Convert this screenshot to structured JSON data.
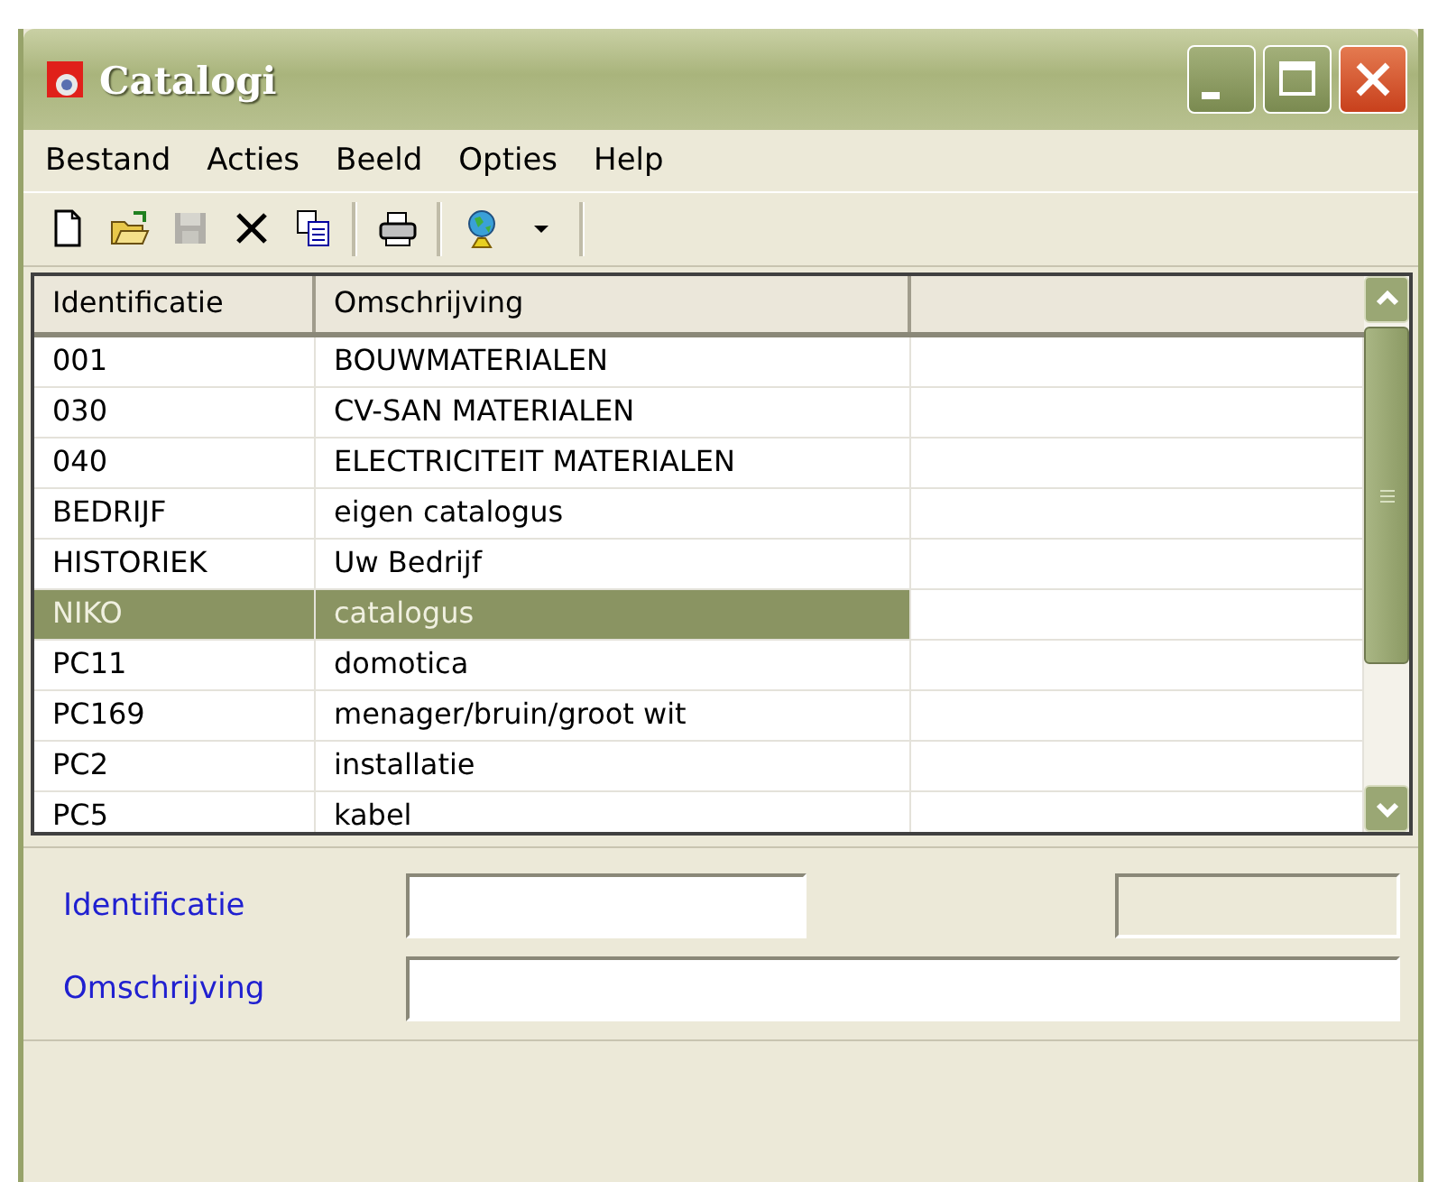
{
  "window": {
    "title": "Catalogi"
  },
  "menu": [
    {
      "label": "Bestand"
    },
    {
      "label": "Acties"
    },
    {
      "label": "Beeld"
    },
    {
      "label": "Opties"
    },
    {
      "label": "Help"
    }
  ],
  "toolbar": [
    {
      "kind": "new",
      "disabled": false
    },
    {
      "kind": "open",
      "disabled": false
    },
    {
      "kind": "save",
      "disabled": true
    },
    {
      "kind": "delete",
      "disabled": false
    },
    {
      "kind": "copy",
      "disabled": false
    },
    {
      "kind": "separator"
    },
    {
      "kind": "print",
      "disabled": false
    },
    {
      "kind": "separator"
    },
    {
      "kind": "globe",
      "disabled": false
    },
    {
      "kind": "dropdown",
      "disabled": false
    },
    {
      "kind": "separator"
    }
  ],
  "table": {
    "columns": [
      "Identificatie",
      "Omschrijving"
    ],
    "rows": [
      {
        "cells": [
          "001",
          "BOUWMATERIALEN"
        ],
        "selected": false
      },
      {
        "cells": [
          "030",
          "CV-SAN MATERIALEN"
        ],
        "selected": false
      },
      {
        "cells": [
          "040",
          "ELECTRICITEIT MATERIALEN"
        ],
        "selected": false
      },
      {
        "cells": [
          "BEDRIJF",
          "eigen catalogus"
        ],
        "selected": false
      },
      {
        "cells": [
          "HISTORIEK",
          "Uw Bedrijf"
        ],
        "selected": false
      },
      {
        "cells": [
          "NIKO",
          "catalogus"
        ],
        "selected": true
      },
      {
        "cells": [
          "PC11",
          "domotica"
        ],
        "selected": false
      },
      {
        "cells": [
          "PC169",
          "menager/bruin/groot wit"
        ],
        "selected": false
      },
      {
        "cells": [
          "PC2",
          "installatie"
        ],
        "selected": false
      },
      {
        "cells": [
          "PC5",
          "kabel"
        ],
        "selected": false
      }
    ]
  },
  "detail": {
    "fields": [
      {
        "label": "Identificatie",
        "kind": "short"
      },
      {
        "label": "Omschrijving",
        "kind": "full"
      }
    ],
    "side_field": {
      "disabled": true
    }
  }
}
